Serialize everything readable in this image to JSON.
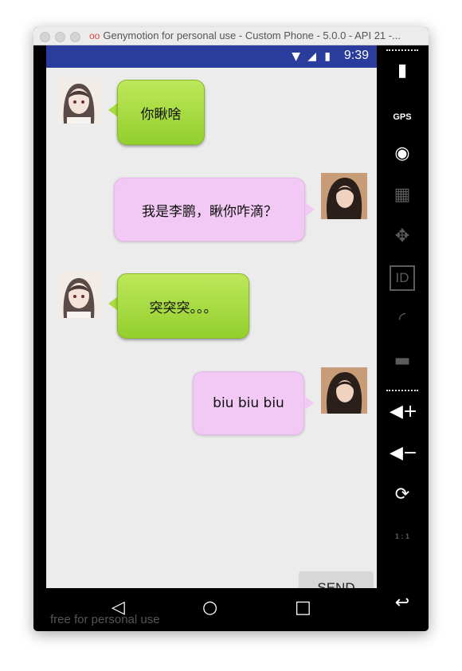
{
  "window": {
    "title": "Genymotion for personal use - Custom Phone - 5.0.0 - API 21 -..."
  },
  "status_bar": {
    "time": "9:39"
  },
  "messages": [
    {
      "side": "left",
      "text": "你瞅啥"
    },
    {
      "side": "right",
      "text": "我是李鹏，瞅你咋滴？"
    },
    {
      "side": "left",
      "text": "突突突。。。"
    },
    {
      "side": "right",
      "text": "biu biu biu"
    }
  ],
  "composer": {
    "send_label": "SEND",
    "input_value": ""
  },
  "watermark": "free for personal use",
  "side_panel": {
    "gps_label": "GPS",
    "id_label": "ID",
    "ratio_label": "1 : 1"
  },
  "colors": {
    "status_bar": "#2a3c9c",
    "chat_background": "#ececec",
    "bubble_green": "#a8dc40",
    "bubble_pink": "#f2c9f4"
  }
}
